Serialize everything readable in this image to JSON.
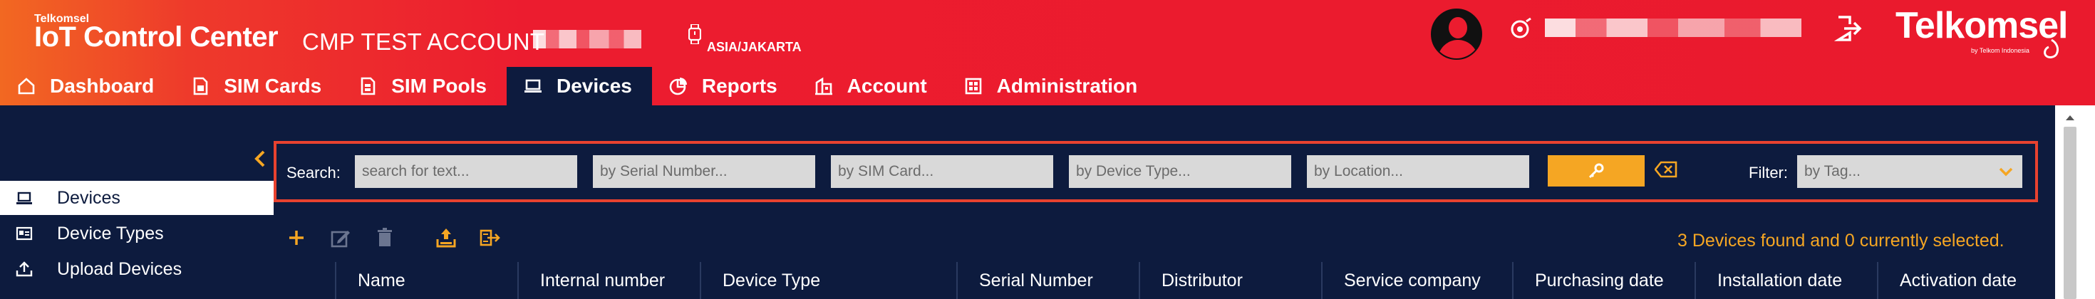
{
  "header": {
    "brand_small": "Telkomsel",
    "brand_title": "IoT Control Center",
    "account_name": "CMP TEST ACCOUNT",
    "timezone": "ASIA/JAKARTA",
    "logo_text": "Telkomsel",
    "logo_sub": "by Telkom Indonesia"
  },
  "nav": {
    "items": [
      {
        "label": "Dashboard",
        "icon": "home-icon"
      },
      {
        "label": "SIM Cards",
        "icon": "sim-card-icon"
      },
      {
        "label": "SIM Pools",
        "icon": "sim-pool-icon"
      },
      {
        "label": "Devices",
        "icon": "laptop-icon",
        "active": true
      },
      {
        "label": "Reports",
        "icon": "pie-chart-icon"
      },
      {
        "label": "Account",
        "icon": "building-icon"
      },
      {
        "label": "Administration",
        "icon": "admin-icon"
      }
    ]
  },
  "sidebar": {
    "items": [
      {
        "label": "Devices",
        "icon": "laptop-icon",
        "active": true
      },
      {
        "label": "Device Types",
        "icon": "id-card-icon"
      },
      {
        "label": "Upload Devices",
        "icon": "upload-icon"
      }
    ]
  },
  "search": {
    "label": "Search:",
    "text_placeholder": "search for text...",
    "serial_placeholder": "by Serial Number...",
    "sim_placeholder": "by SIM Card...",
    "type_placeholder": "by Device Type...",
    "location_placeholder": "by Location...",
    "filter_label": "Filter:",
    "tag_placeholder": "by Tag..."
  },
  "status": {
    "found_text": "3 Devices found and 0 currently selected."
  },
  "table": {
    "columns": [
      "Name",
      "Internal number",
      "Device Type",
      "Serial Number",
      "Distributor",
      "Service company",
      "Purchasing date",
      "Installation date",
      "Activation date"
    ]
  },
  "colors": {
    "header_red": "#ec1c2f",
    "navy": "#0d1b3e",
    "accent_orange": "#f5a623",
    "search_border": "#e8422f"
  }
}
